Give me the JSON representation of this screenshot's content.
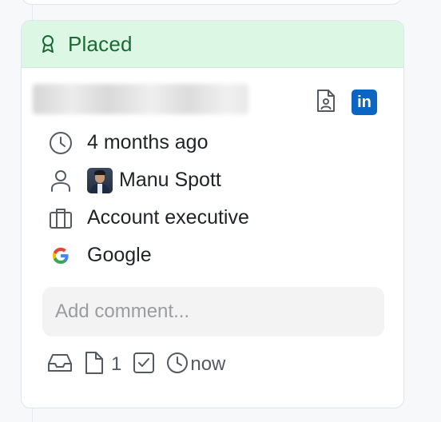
{
  "card": {
    "status": {
      "label": "Placed",
      "icon": "award-ribbon-icon",
      "color": "#1b6a34",
      "background": "#dcf7e3"
    },
    "candidate": {
      "name_redacted": true,
      "resume_icon": "resume-document-icon",
      "linkedin_icon": "linkedin-icon",
      "linkedin_label": "in"
    },
    "details": {
      "time_ago": "4 months ago",
      "owner": "Manu Spott",
      "job_title": "Account executive",
      "company": "Google"
    },
    "comment": {
      "placeholder": "Add comment...",
      "value": ""
    },
    "footer": {
      "attachments_count": "1",
      "updated": "now"
    }
  },
  "colors": {
    "accent_blue": "#0a66c2",
    "border": "#dfe5ee",
    "icon_gray": "#555a61"
  }
}
